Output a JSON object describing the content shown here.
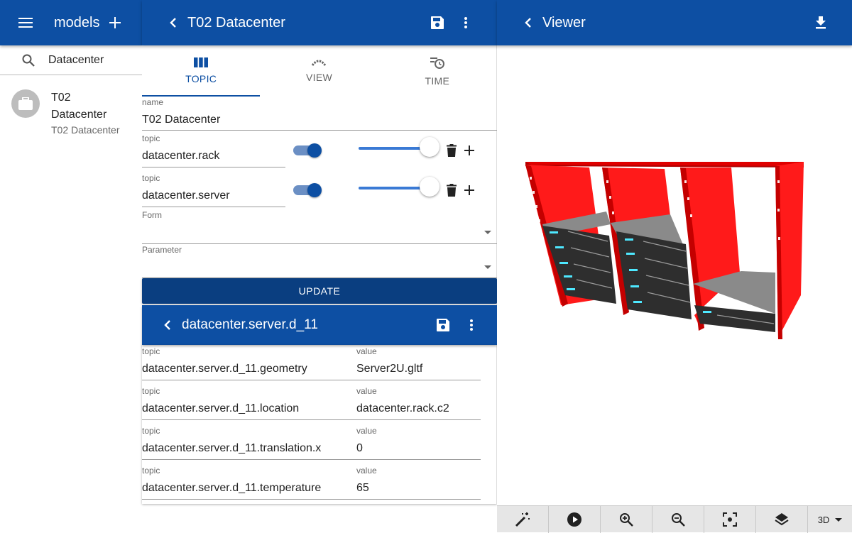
{
  "left": {
    "title": "models",
    "search_value": "Datacenter",
    "items": [
      {
        "title_line1": "T02",
        "title_line2": "Datacenter",
        "subtitle": "T02 Datacenter"
      }
    ]
  },
  "middle": {
    "title": "T02 Datacenter",
    "tabs": [
      {
        "label": "TOPIC",
        "icon": "columns-icon"
      },
      {
        "label": "VIEW",
        "icon": "view-icon"
      },
      {
        "label": "TIME",
        "icon": "history-icon"
      }
    ],
    "name_label": "name",
    "name_value": "T02 Datacenter",
    "topics": [
      {
        "label": "topic",
        "value": "datacenter.rack"
      },
      {
        "label": "topic",
        "value": "datacenter.server"
      }
    ],
    "form_label": "Form",
    "parameter_label": "Parameter",
    "update_label": "UPDATE",
    "sub_title": "datacenter.server.d_11",
    "sub_rows": [
      {
        "topic_label": "topic",
        "topic": "datacenter.server.d_11.geometry",
        "value_label": "value",
        "value": "Server2U.gltf"
      },
      {
        "topic_label": "topic",
        "topic": "datacenter.server.d_11.location",
        "value_label": "value",
        "value": "datacenter.rack.c2"
      },
      {
        "topic_label": "topic",
        "topic": "datacenter.server.d_11.translation.x",
        "value_label": "value",
        "value": "0"
      },
      {
        "topic_label": "topic",
        "topic": "datacenter.server.d_11.temperature",
        "value_label": "value",
        "value": "65"
      }
    ]
  },
  "right": {
    "title": "Viewer",
    "mode": "3D"
  },
  "colors": {
    "primary": "#0d4fa3",
    "rack": "#ff1a1a",
    "server": "#333333",
    "led": "#4ee8ff"
  }
}
